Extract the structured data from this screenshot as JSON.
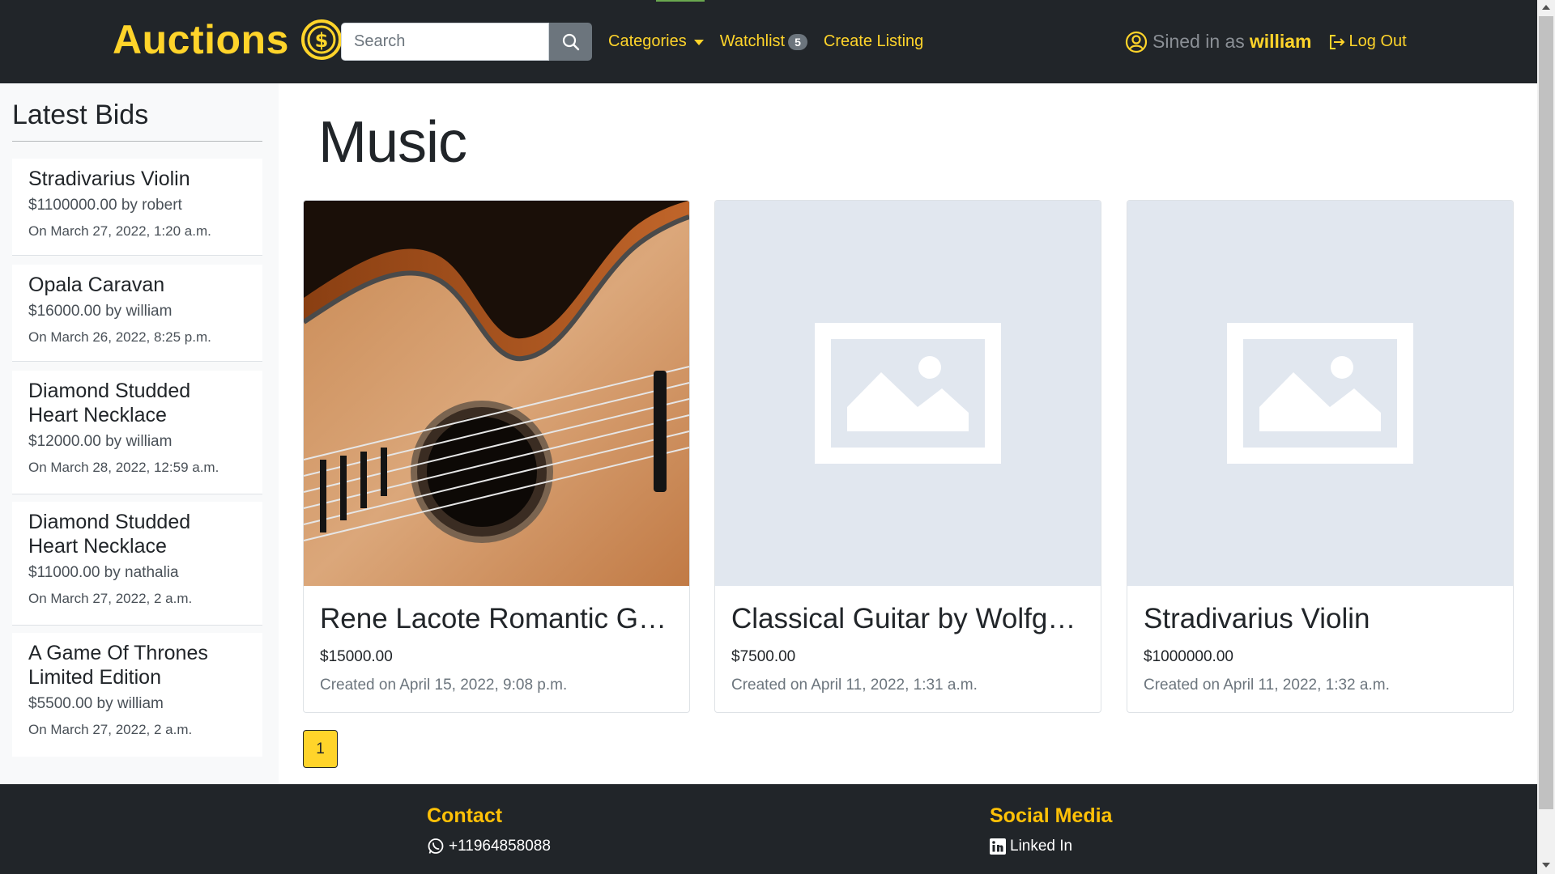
{
  "navbar": {
    "brand": "Auctions",
    "brand_icon": "dollar-coin-icon",
    "search": {
      "placeholder": "Search",
      "value": ""
    },
    "links": {
      "categories": "Categories",
      "watchlist": "Watchlist",
      "watchlist_count": "5",
      "create_listing": "Create Listing"
    },
    "user": {
      "signed_in_text": "Sined in as",
      "username": "william",
      "logout": "Log Out"
    }
  },
  "sidebar": {
    "title": "Latest Bids",
    "bids": [
      {
        "item": "Stradivarius Violin",
        "amount_line": "$1100000.00 by robert",
        "date": "On March 27, 2022, 1:20 a.m."
      },
      {
        "item": "Opala Caravan",
        "amount_line": "$16000.00 by william",
        "date": "On March 26, 2022, 8:25 p.m."
      },
      {
        "item": "Diamond Studded Heart Necklace",
        "amount_line": "$12000.00 by william",
        "date": "On March 28, 2022, 12:59 a.m."
      },
      {
        "item": "Diamond Studded Heart Necklace",
        "amount_line": "$11000.00 by nathalia",
        "date": "On March 27, 2022, 2 a.m."
      },
      {
        "item": "A Game Of Thrones Limited Edition",
        "amount_line": "$5500.00 by william",
        "date": "On March 27, 2022, 2 a.m."
      }
    ]
  },
  "main": {
    "title": "Music",
    "listings": [
      {
        "title": "Rene Lacote Romantic Guitar",
        "price": "$15000.00",
        "created": "Created on April 15, 2022, 9:08 p.m.",
        "image": "guitar-photo"
      },
      {
        "title": "Classical Guitar by Wolfgang",
        "price": "$7500.00",
        "created": "Created on April 11, 2022, 1:31 a.m.",
        "image": "image-placeholder-icon"
      },
      {
        "title": "Stradivarius Violin",
        "price": "$1000000.00",
        "created": "Created on April 11, 2022, 1:32 a.m.",
        "image": "image-placeholder-icon"
      }
    ],
    "pagination": {
      "current_page": "1"
    }
  },
  "footer": {
    "contact": {
      "heading": "Contact",
      "phone": "+11964858088",
      "icon": "whatsapp-icon"
    },
    "social": {
      "heading": "Social Media",
      "linkedin": "Linked In",
      "icon": "linkedin-icon"
    }
  },
  "colors": {
    "navbar_bg": "#212529",
    "accent_yellow": "#ffd42a",
    "footer_heading": "#ffc107",
    "sidebar_bg": "#f8f9fa",
    "placeholder_bg": "#e1e7ef"
  }
}
